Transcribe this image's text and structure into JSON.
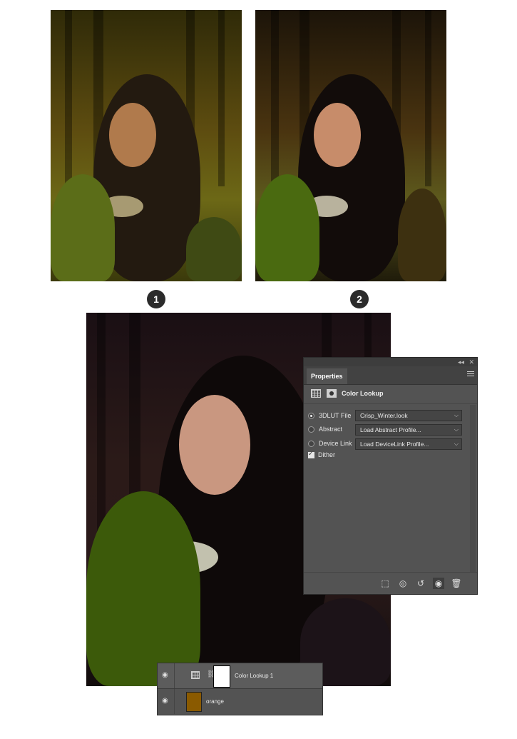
{
  "steps": {
    "one": "1",
    "two": "2"
  },
  "properties_panel": {
    "tab_label": "Properties",
    "title": "Color Lookup",
    "options": [
      {
        "label": "3DLUT File",
        "value": "Crisp_Winter.look",
        "selected": true
      },
      {
        "label": "Abstract",
        "value": "Load Abstract Profile...",
        "selected": false
      },
      {
        "label": "Device Link",
        "value": "Load DeviceLink Profile...",
        "selected": false
      }
    ],
    "dither_label": "Dither",
    "dither_checked": true,
    "window_controls": {
      "collapse": "◂◂",
      "close": "✕"
    },
    "bottom_icons": [
      "clip-to-layer-icon",
      "view-previous-icon",
      "reset-icon",
      "visibility-icon",
      "delete-icon"
    ]
  },
  "layers": [
    {
      "name": "Color Lookup 1",
      "type": "adjustment",
      "visible": true,
      "selected": true
    },
    {
      "name": "orange",
      "type": "fill",
      "visible": true,
      "selected": false,
      "color": "#8a5a00"
    }
  ]
}
